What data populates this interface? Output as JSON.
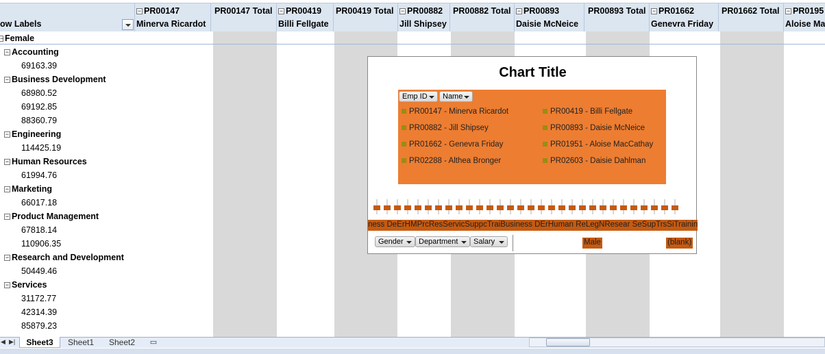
{
  "header": {
    "row_labels": "ow Labels",
    "columns": [
      {
        "id": "PR00147",
        "name": "Minerva Ricardot"
      },
      {
        "total": "PR00147 Total"
      },
      {
        "id": "PR00419",
        "name": "Billi Fellgate"
      },
      {
        "total": "PR00419 Total"
      },
      {
        "id": "PR00882",
        "name": "Jill Shipsey"
      },
      {
        "total": "PR00882 Total"
      },
      {
        "id": "PR00893",
        "name": "Daisie McNeice"
      },
      {
        "total": "PR00893 Total"
      },
      {
        "id": "PR01662",
        "name": "Genevra Friday"
      },
      {
        "total": "PR01662 Total"
      },
      {
        "id": "PR0195",
        "name": "Aloise Ma"
      }
    ]
  },
  "rows": {
    "female": "Female",
    "r0": "Accounting",
    "r1": "69163.39",
    "r2": "Business Development",
    "r3": "68980.52",
    "r4": "69192.85",
    "r5": "88360.79",
    "r6": "Engineering",
    "r7": "114425.19",
    "r8": "Human Resources",
    "r9": "61994.76",
    "r10": "Marketing",
    "r11": "66017.18",
    "r12": "Product Management",
    "r13": "67818.14",
    "r14": "110906.35",
    "r15": "Research and Development",
    "r16": "50449.46",
    "r17": "Services",
    "r18": "31172.77",
    "r19": "42314.39",
    "r20": "85879.23"
  },
  "tabs": [
    "Sheet3",
    "Sheet1",
    "Sheet2"
  ],
  "chart": {
    "title": "Chart Title",
    "filter_emp": "Emp ID",
    "filter_name": "Name",
    "legend": [
      "PR00147 - Minerva Ricardot",
      "PR00419 - Billi Fellgate",
      "PR00882 -  Jill Shipsey",
      "PR00893 - Daisie McNeice",
      "PR01662 - Genevra Friday",
      "PR01951 - Aloise MacCathay",
      "PR02288 - Althea  Bronger",
      "PR02603 - Daisie Dahlman"
    ],
    "axis_text": "ness DeErHMPrcResServicSuppcTraiBusiness DErHuman ReLegNResear SeSupTrsSiTraining",
    "field_gender": "Gender",
    "field_department": "Department",
    "field_salary": "Salary",
    "male": "Male",
    "blank": "(blank)"
  },
  "colors": {
    "header_bg": "#dce6f1",
    "total_col": "#d9d9d9",
    "legend_bg": "#ed7d31",
    "axis_bar": "#c55a11"
  }
}
